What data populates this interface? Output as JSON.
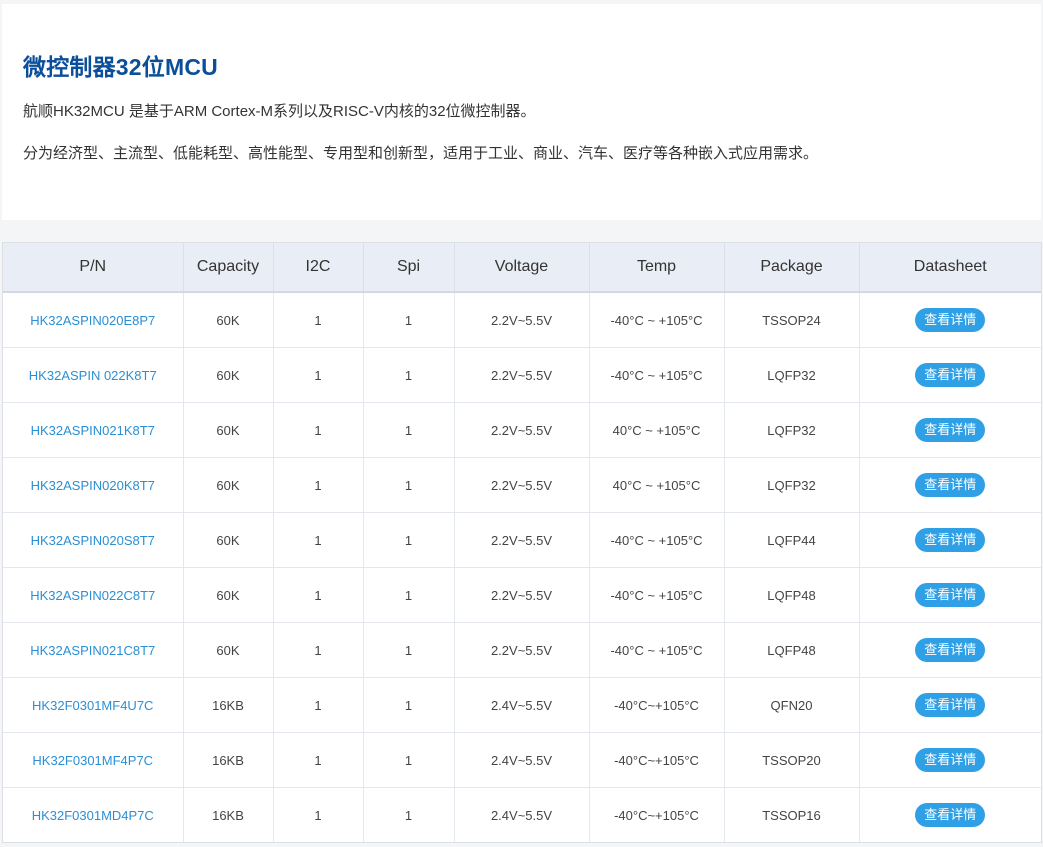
{
  "intro": {
    "title": "微控制器32位MCU",
    "description_1": "航顺HK32MCU 是基于ARM Cortex-M系列以及RISC-V内核的32位微控制器。",
    "description_2": "分为经济型、主流型、低能耗型、高性能型、专用型和创新型，适用于工业、商业、汽车、医疗等各种嵌入式应用需求。"
  },
  "colors": {
    "title": "#0b4f9a",
    "link": "#2a8fd4",
    "button": "#2f9fe6",
    "header_bg": "#e9edf5"
  },
  "table": {
    "headers": [
      "P/N",
      "Capacity",
      "I2C",
      "Spi",
      "Voltage",
      "Temp",
      "Package",
      "Datasheet"
    ],
    "button_label": "查看详情",
    "rows": [
      {
        "pn": "HK32ASPIN020E8P7",
        "capacity": "60K",
        "i2c": "1",
        "spi": "1",
        "voltage": "2.2V~5.5V",
        "temp": "-40°C ~ +105°C",
        "package": "TSSOP24"
      },
      {
        "pn": "HK32ASPIN 022K8T7",
        "capacity": "60K",
        "i2c": "1",
        "spi": "1",
        "voltage": "2.2V~5.5V",
        "temp": "-40°C ~ +105°C",
        "package": "LQFP32"
      },
      {
        "pn": "HK32ASPIN021K8T7",
        "capacity": "60K",
        "i2c": "1",
        "spi": "1",
        "voltage": "2.2V~5.5V",
        "temp": "40°C ~ +105°C",
        "package": "LQFP32"
      },
      {
        "pn": "HK32ASPIN020K8T7",
        "capacity": "60K",
        "i2c": "1",
        "spi": "1",
        "voltage": "2.2V~5.5V",
        "temp": "40°C ~ +105°C",
        "package": "LQFP32"
      },
      {
        "pn": "HK32ASPIN020S8T7",
        "capacity": "60K",
        "i2c": "1",
        "spi": "1",
        "voltage": "2.2V~5.5V",
        "temp": "-40°C ~ +105°C",
        "package": "LQFP44"
      },
      {
        "pn": "HK32ASPIN022C8T7",
        "capacity": "60K",
        "i2c": "1",
        "spi": "1",
        "voltage": "2.2V~5.5V",
        "temp": "-40°C ~ +105°C",
        "package": "LQFP48"
      },
      {
        "pn": "HK32ASPIN021C8T7",
        "capacity": "60K",
        "i2c": "1",
        "spi": "1",
        "voltage": "2.2V~5.5V",
        "temp": "-40°C ~ +105°C",
        "package": "LQFP48"
      },
      {
        "pn": "HK32F0301MF4U7C",
        "capacity": "16KB",
        "i2c": "1",
        "spi": "1",
        "voltage": "2.4V~5.5V",
        "temp": "-40°C~+105°C",
        "package": "QFN20"
      },
      {
        "pn": "HK32F0301MF4P7C",
        "capacity": "16KB",
        "i2c": "1",
        "spi": "1",
        "voltage": "2.4V~5.5V",
        "temp": "-40°C~+105°C",
        "package": "TSSOP20"
      },
      {
        "pn": "HK32F0301MD4P7C",
        "capacity": "16KB",
        "i2c": "1",
        "spi": "1",
        "voltage": "2.4V~5.5V",
        "temp": "-40°C~+105°C",
        "package": "TSSOP16"
      }
    ]
  }
}
